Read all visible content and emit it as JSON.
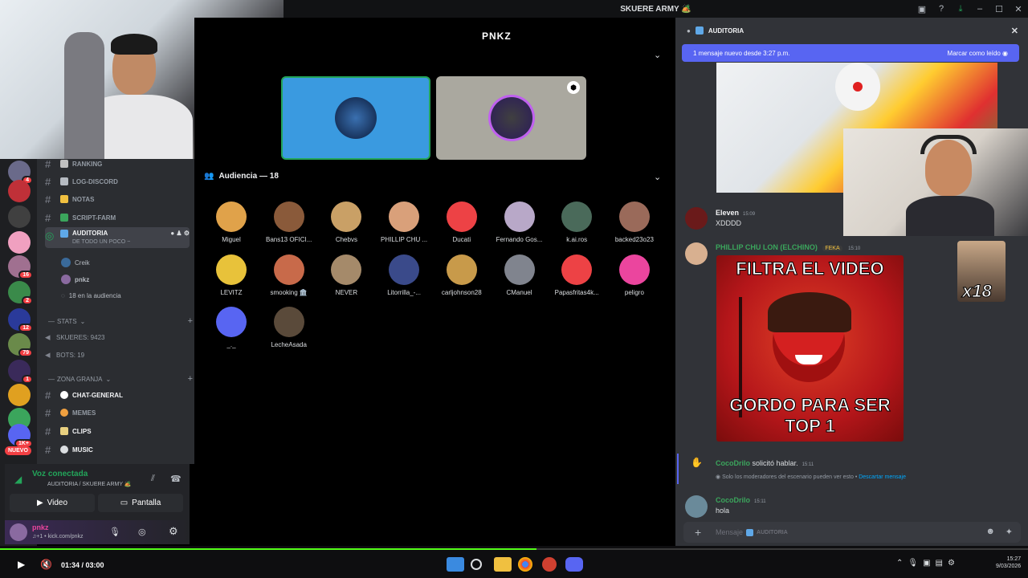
{
  "window": {
    "title": "SKUERE ARMY 🏕️"
  },
  "stage": {
    "logo": "PNKZ",
    "audience_header": "Audiencia — 18",
    "audience": [
      {
        "name": "Miguel",
        "color": "#e0a24a"
      },
      {
        "name": "Bans13 OFICI...",
        "color": "#8a5a3a"
      },
      {
        "name": "Chebvs",
        "color": "#c9a066"
      },
      {
        "name": "PHILLIP CHU ...",
        "color": "#d9a07a"
      },
      {
        "name": "Ducati",
        "color": "#ed4245"
      },
      {
        "name": "Fernando Gos...",
        "color": "#b8a8c8"
      },
      {
        "name": "k.ai.ros",
        "color": "#4a6a5a"
      },
      {
        "name": "backed23o23",
        "color": "#9a6a5a"
      },
      {
        "name": "LEVITZ",
        "color": "#e8c23a"
      },
      {
        "name": "smooking 🏛️",
        "color": "#c86a4a"
      },
      {
        "name": "NEVER",
        "color": "#a58a6a"
      },
      {
        "name": "Litorrilla_-...",
        "color": "#3a4a8a"
      },
      {
        "name": "carljohnson28",
        "color": "#c89a4a"
      },
      {
        "name": "CManuel",
        "color": "#80848e"
      },
      {
        "name": "Papasfritas4k...",
        "color": "#ed4245"
      },
      {
        "name": "peligro",
        "color": "#eb459e"
      },
      {
        "name": "_._",
        "color": "#5865f2"
      },
      {
        "name": "LecheAsada",
        "color": "#5a4a3a"
      }
    ]
  },
  "channels": {
    "items": [
      {
        "name": "RANKING",
        "color": "#c0c0c0"
      },
      {
        "name": "LOG-DISCORD",
        "color": "#b5bac1"
      },
      {
        "name": "NOTAS",
        "color": "#f0c040"
      },
      {
        "name": "SCRIPT-FARM",
        "color": "#3ba55c"
      }
    ],
    "active": {
      "name": "AUDITORIA",
      "subtitle": "DE TODO UN POCO ~"
    },
    "stage_members": [
      "Creik",
      "pnkz"
    ],
    "audience_count": "18 en la audiencia",
    "cat_stats": "STATS",
    "stats": [
      "SKUERES: 9423",
      "BOTS: 19"
    ],
    "cat_granja": "ZONA GRANJA",
    "granja": [
      "CHAT-GENERAL",
      "MEMES",
      "CLIPS",
      "MUSIC"
    ],
    "nuevo": "NUEVO"
  },
  "voice": {
    "status": "Voz conectada",
    "location": "AUDITORIA / SKUERE ARMY 🏕️",
    "video_label": "Video",
    "screen_label": "Pantalla",
    "username": "pnkz",
    "usersub": "♫+1 • kick.com/pnkz"
  },
  "servers": [
    {
      "badge": "4",
      "color": "#6a6a8a"
    },
    {
      "badge": "",
      "color": "#c03038"
    },
    {
      "badge": "",
      "color": "#404040"
    },
    {
      "badge": "",
      "color": "#f0a0c0"
    },
    {
      "badge": "16",
      "color": "#a07090"
    },
    {
      "badge": "2",
      "color": "#3a8a4a"
    },
    {
      "badge": "12",
      "color": "#2a3a9a"
    },
    {
      "badge": "79",
      "color": "#6a8a4a"
    },
    {
      "badge": "1",
      "color": "#3a2a5a"
    },
    {
      "badge": "",
      "color": "#e0a020"
    },
    {
      "badge": "",
      "color": "#3ba55c"
    },
    {
      "badge": "1K+",
      "color": "#5865f2"
    }
  ],
  "chat": {
    "header": "AUDITORIA",
    "new_banner": "1 mensaje nuevo desde 3:27 p.m.",
    "mark_read": "Marcar como leído",
    "messages": [
      {
        "user": "Eleven",
        "time": "15:09",
        "text": "XDDDD",
        "color": "#f2f3f5"
      },
      {
        "user": "PHILLIP CHU LON (ELCHINO)",
        "tag": "FEKA",
        "time": "15:10",
        "color": "#3ba55c"
      }
    ],
    "meme_top": "FILTRA EL VIDEO",
    "meme_bottom": "GORDO PARA SER TOP 1",
    "sticker_text": "x18",
    "request": {
      "user": "CocoDrilo",
      "action": "solicitó hablar.",
      "time": "15:11",
      "note": "Solo los moderadores del escenario pueden ver esto",
      "link": "Descartar mensaje"
    },
    "last": {
      "user": "CocoDrilo",
      "time": "15:11",
      "text": "hola"
    },
    "composer_placeholder": "Mensaje",
    "composer_channel": "AUDITORIA"
  },
  "player": {
    "time": "01:34 / 03:00",
    "progress": 0.5222,
    "clock": "15:27",
    "date": "9/03/2026"
  }
}
